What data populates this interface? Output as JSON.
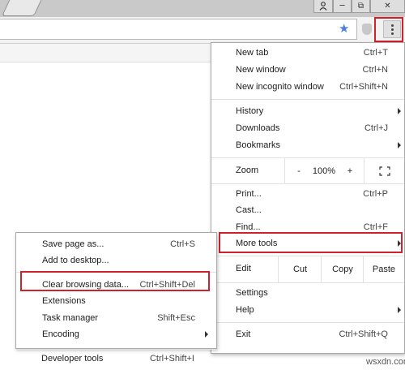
{
  "window": {
    "user_icon": "user-icon",
    "min_label": "─",
    "restore_label": "⧉",
    "close_label": "✕"
  },
  "toolbar": {
    "star_icon": "star-icon",
    "extension_icon": "shield-icon",
    "menu_icon": "three-dot-menu-icon"
  },
  "main_menu": {
    "new_tab": {
      "label": "New tab",
      "shortcut": "Ctrl+T"
    },
    "new_window": {
      "label": "New window",
      "shortcut": "Ctrl+N"
    },
    "new_incognito": {
      "label": "New incognito window",
      "shortcut": "Ctrl+Shift+N"
    },
    "history": {
      "label": "History"
    },
    "downloads": {
      "label": "Downloads",
      "shortcut": "Ctrl+J"
    },
    "bookmarks": {
      "label": "Bookmarks"
    },
    "zoom": {
      "label": "Zoom",
      "minus": "-",
      "value": "100%",
      "plus": "+"
    },
    "print": {
      "label": "Print...",
      "shortcut": "Ctrl+P"
    },
    "cast": {
      "label": "Cast..."
    },
    "find": {
      "label": "Find...",
      "shortcut": "Ctrl+F"
    },
    "more_tools": {
      "label": "More tools"
    },
    "edit": {
      "label": "Edit",
      "cut": "Cut",
      "copy": "Copy",
      "paste": "Paste"
    },
    "settings": {
      "label": "Settings"
    },
    "help": {
      "label": "Help"
    },
    "exit": {
      "label": "Exit",
      "shortcut": "Ctrl+Shift+Q"
    }
  },
  "sub_menu": {
    "save_page": {
      "label": "Save page as...",
      "shortcut": "Ctrl+S"
    },
    "add_desktop": {
      "label": "Add to desktop..."
    },
    "clear_browsing": {
      "label": "Clear browsing data...",
      "shortcut": "Ctrl+Shift+Del"
    },
    "extensions": {
      "label": "Extensions"
    },
    "task_manager": {
      "label": "Task manager",
      "shortcut": "Shift+Esc"
    },
    "encoding": {
      "label": "Encoding"
    },
    "developer_tools": {
      "label": "Developer tools",
      "shortcut": "Ctrl+Shift+I"
    }
  },
  "watermark": "wsxdn.com",
  "colors": {
    "highlight": "#d0212d",
    "star": "#4a7fe0"
  }
}
